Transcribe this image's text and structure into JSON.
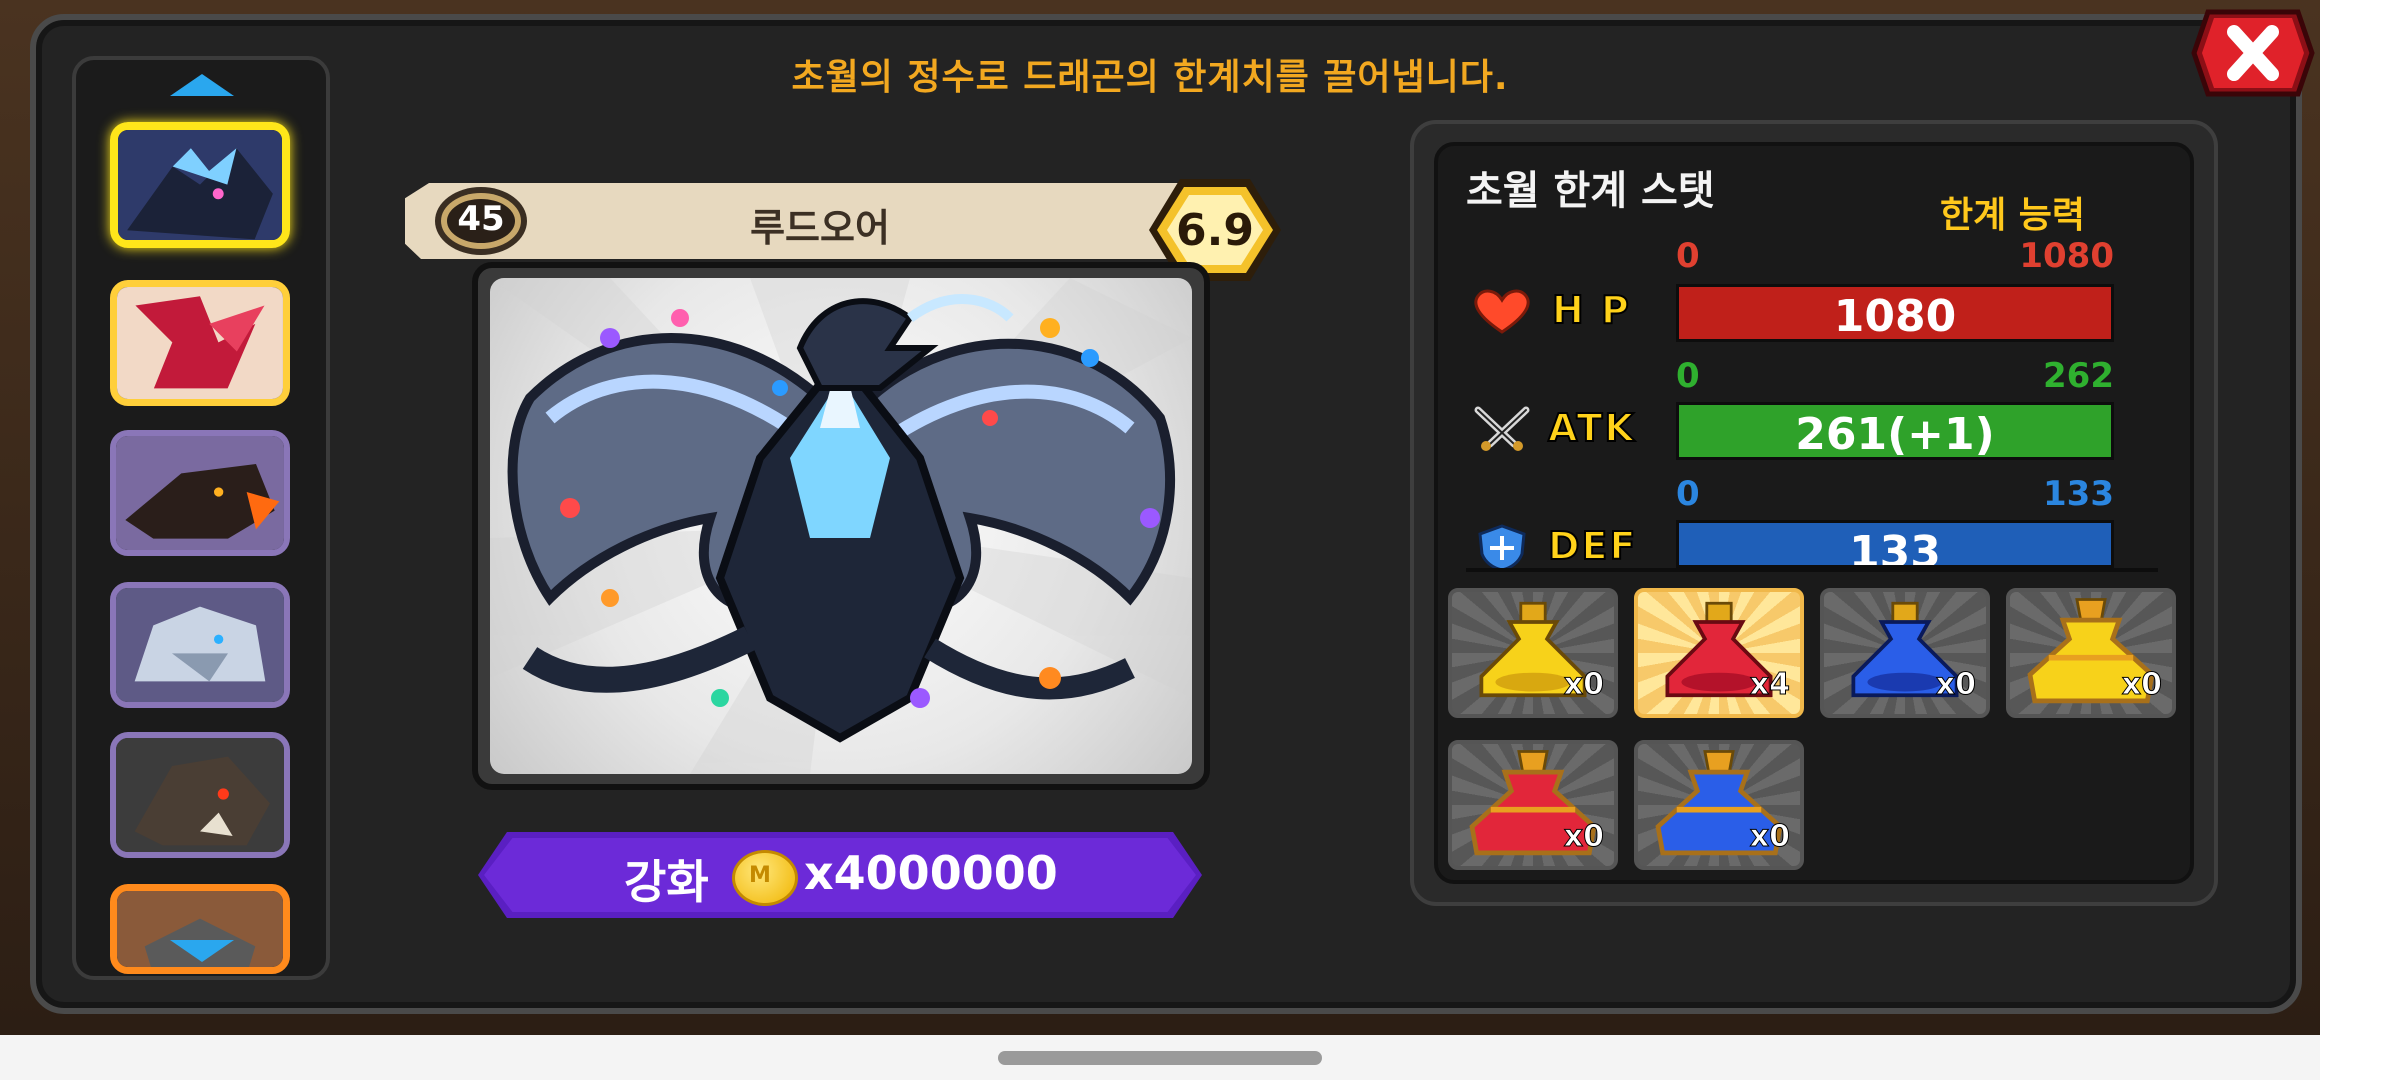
{
  "title": "초월의 정수로 드래곤의 한계치를 끌어냅니다.",
  "dragon": {
    "level": "45",
    "name": "루드오어",
    "grade": "6.9"
  },
  "upgrade": {
    "label": "강화",
    "cost": "x4000000",
    "coin_icon": "gold-coin-icon"
  },
  "stats_panel": {
    "title": "초월 한계 스탯",
    "limit_label": "한계 능력",
    "stats": [
      {
        "label": "H P",
        "icon": "heart-icon",
        "min": "0",
        "max": "1080",
        "value": "1080",
        "fill": 1.0,
        "color": "#c0201a",
        "min_color": "#e04030",
        "max_color": "#e04030"
      },
      {
        "label": "ATK",
        "icon": "crossed-swords-icon",
        "min": "0",
        "max": "262",
        "value": "261(+1)",
        "fill": 1.0,
        "color": "#2fa22a",
        "min_color": "#2fb02f",
        "max_color": "#2fb02f"
      },
      {
        "label": "DEF",
        "icon": "shield-icon",
        "min": "0",
        "max": "133",
        "value": "133",
        "fill": 1.0,
        "color": "#1f5fb8",
        "min_color": "#2b86e0",
        "max_color": "#2b86e0"
      }
    ]
  },
  "items": [
    {
      "count": "x0",
      "color": "yellow",
      "icon": "yellow-potion-icon"
    },
    {
      "count": "x4",
      "color": "red",
      "icon": "red-potion-icon",
      "active": true
    },
    {
      "count": "x0",
      "color": "blue",
      "icon": "blue-potion-icon"
    },
    {
      "count": "x0",
      "color": "gold-yellow",
      "icon": "large-yellow-potion-icon"
    },
    {
      "count": "x0",
      "color": "gold-red",
      "icon": "large-red-potion-icon"
    },
    {
      "count": "x0",
      "color": "gold-blue",
      "icon": "large-blue-potion-icon"
    }
  ],
  "sidebar": {
    "dragon_count": 6
  }
}
